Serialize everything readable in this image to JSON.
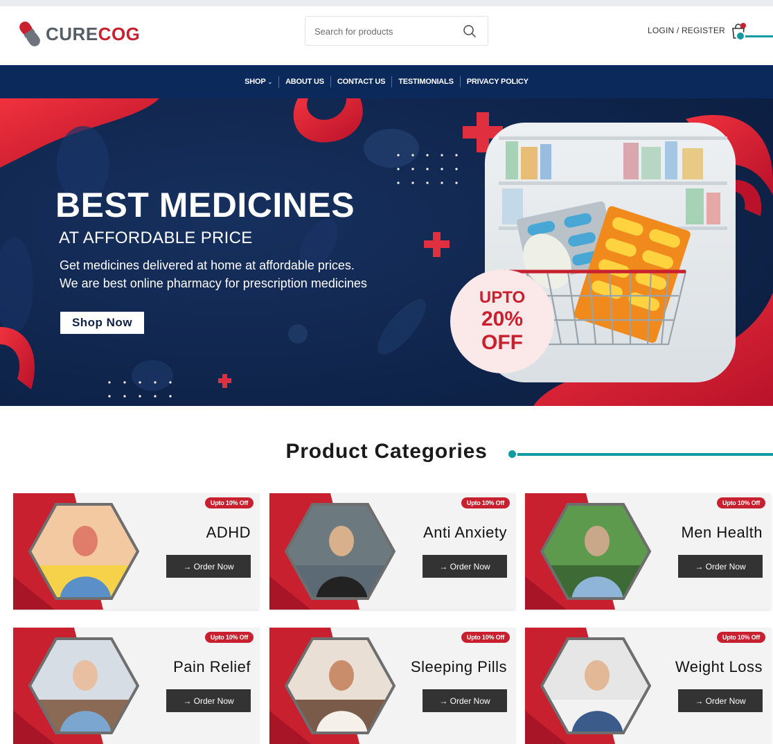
{
  "brand": {
    "name_part1": "CURE",
    "name_part2": "COG",
    "accent_color": "#c8202f",
    "navy_color": "#0b2a5b"
  },
  "header": {
    "search_placeholder": "Search for products",
    "login_label": "LOGIN / REGISTER"
  },
  "nav": {
    "items": [
      "SHOP",
      "ABOUT US",
      "CONTACT US",
      "TESTIMONIALS",
      "PRIVACY POLICY"
    ]
  },
  "hero": {
    "title": "BEST MEDICINES",
    "subtitle": "AT AFFORDABLE PRICE",
    "desc_line1": "Get medicines delivered at home at affordable prices.",
    "desc_line2": "We are best online pharmacy for prescription medicines",
    "cta": "Shop Now",
    "promo_line1": "UPTO",
    "promo_line2": "20%",
    "promo_line3": "OFF"
  },
  "categories": {
    "title": "Product Categories",
    "items": [
      {
        "name": "ADHD",
        "badge": "Upto 10% Off",
        "button": "→ Order Now"
      },
      {
        "name": "Anti Anxiety",
        "badge": "Upto 10% Off",
        "button": "→ Order Now"
      },
      {
        "name": "Men Health",
        "badge": "Upto 10% Off",
        "button": "→ Order Now"
      },
      {
        "name": "Pain Relief",
        "badge": "Upto 10% Off",
        "button": "→ Order Now"
      },
      {
        "name": "Sleeping Pills",
        "badge": "Upto 10% Off",
        "button": "→ Order Now"
      },
      {
        "name": "Weight Loss",
        "badge": "Upto 10% Off",
        "button": "→ Order Now"
      }
    ]
  }
}
